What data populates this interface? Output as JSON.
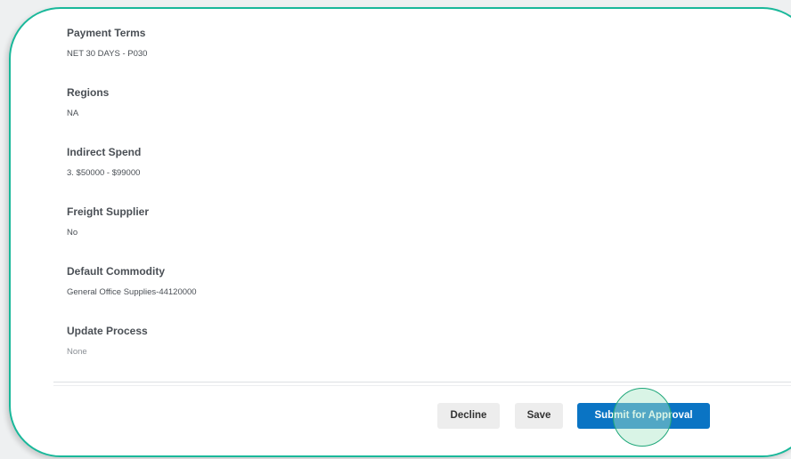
{
  "fields": [
    {
      "label": "Payment Terms",
      "value": "NET 30 DAYS - P030"
    },
    {
      "label": "Regions",
      "value": "NA"
    },
    {
      "label": "Indirect Spend",
      "value": "3. $50000 - $99000"
    },
    {
      "label": "Freight Supplier",
      "value": "No"
    },
    {
      "label": "Default Commodity",
      "value": "General Office Supplies-44120000"
    },
    {
      "label": "Update Process",
      "value": "None"
    }
  ],
  "actions": {
    "decline_label": "Decline",
    "save_label": "Save",
    "submit_label": "Submit for Approval"
  },
  "colors": {
    "accent_border": "#19b89a",
    "primary_button": "#0a74c4",
    "click_highlight": "#1fa77a"
  }
}
